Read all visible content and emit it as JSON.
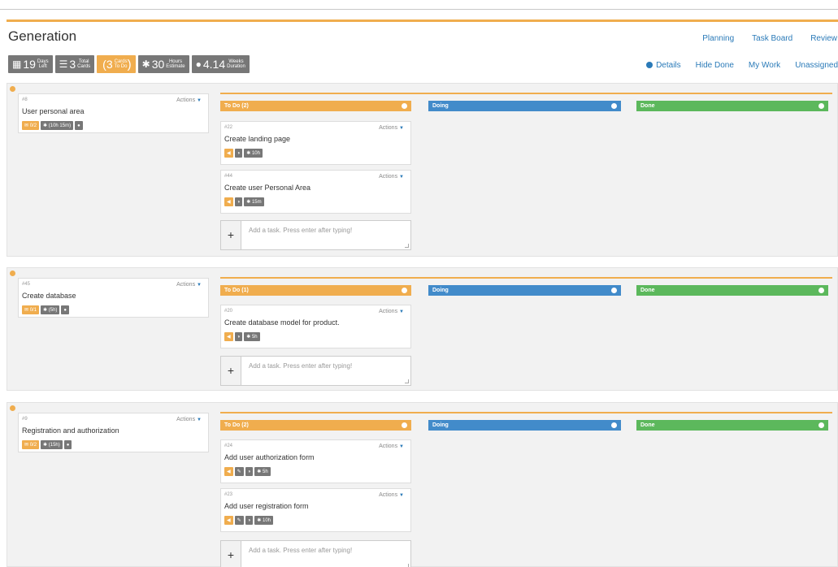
{
  "page": {
    "title": "Generation"
  },
  "top_nav": [
    "Planning",
    "Task Board",
    "Review"
  ],
  "stats": {
    "days": {
      "value": "19",
      "l1": "Days",
      "l2": "Left"
    },
    "cards": {
      "value": "3",
      "l1": "Total",
      "l2": "Cards"
    },
    "todo": {
      "value": "(3",
      "l1": "Cards",
      "l2": "To Do",
      "close": ")"
    },
    "hours": {
      "value": "30",
      "l1": "Hours",
      "l2": "Estimate"
    },
    "weeks": {
      "value": "4.14",
      "l1": "Weeks",
      "l2": "Duration"
    }
  },
  "sub_nav": [
    "Details",
    "Hide Done",
    "My Work",
    "Unassigned"
  ],
  "column_labels": {
    "doing": "Doing",
    "done": "Done"
  },
  "actions_label": "Actions",
  "add_placeholder": "Add a task. Press enter after typing!",
  "stories": [
    {
      "number": "#8",
      "title": "User personal area",
      "badge_count": "0/2",
      "badge_time": "(10h 15m)",
      "todo_label": "To Do (2)",
      "tasks": [
        {
          "number": "#22",
          "title": "Create landing page",
          "estimate": "10h",
          "edit": false
        },
        {
          "number": "#44",
          "title": "Create user Personal Area",
          "estimate": "15m",
          "edit": false
        }
      ]
    },
    {
      "number": "#45",
      "title": "Create database",
      "badge_count": "0/1",
      "badge_time": "(5h)",
      "todo_label": "To Do (1)",
      "tasks": [
        {
          "number": "#20",
          "title": "Create database model for product.",
          "estimate": "5h",
          "edit": false
        }
      ]
    },
    {
      "number": "#9",
      "title": "Registration and authorization",
      "badge_count": "0/2",
      "badge_time": "(15h)",
      "todo_label": "To Do (2)",
      "tasks": [
        {
          "number": "#24",
          "title": "Add user authorization form",
          "estimate": "5h",
          "edit": true
        },
        {
          "number": "#23",
          "title": "Add user registration form",
          "estimate": "10h",
          "edit": true
        }
      ]
    }
  ]
}
